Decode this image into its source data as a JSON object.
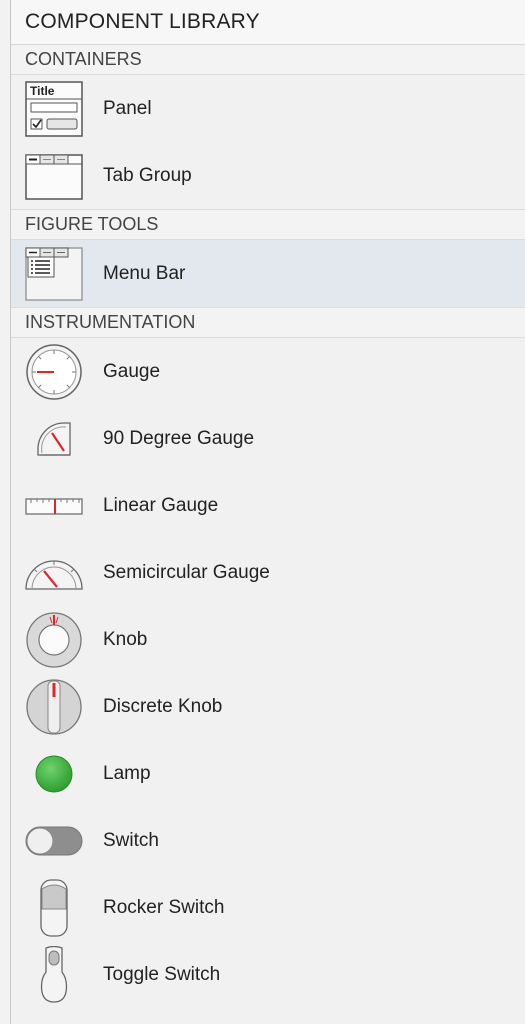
{
  "header": {
    "title": "COMPONENT LIBRARY"
  },
  "sections": {
    "containers": {
      "title": "CONTAINERS",
      "items": [
        {
          "label": "Panel",
          "icon": "panel-icon",
          "icon_text": "Title"
        },
        {
          "label": "Tab Group",
          "icon": "tab-group-icon"
        }
      ]
    },
    "figure_tools": {
      "title": "FIGURE TOOLS",
      "items": [
        {
          "label": "Menu Bar",
          "icon": "menu-bar-icon",
          "selected": true
        }
      ]
    },
    "instrumentation": {
      "title": "INSTRUMENTATION",
      "items": [
        {
          "label": "Gauge",
          "icon": "gauge-icon"
        },
        {
          "label": "90 Degree Gauge",
          "icon": "ninety-degree-gauge-icon"
        },
        {
          "label": "Linear Gauge",
          "icon": "linear-gauge-icon"
        },
        {
          "label": "Semicircular Gauge",
          "icon": "semicircular-gauge-icon"
        },
        {
          "label": "Knob",
          "icon": "knob-icon"
        },
        {
          "label": "Discrete Knob",
          "icon": "discrete-knob-icon"
        },
        {
          "label": "Lamp",
          "icon": "lamp-icon"
        },
        {
          "label": "Switch",
          "icon": "switch-icon"
        },
        {
          "label": "Rocker Switch",
          "icon": "rocker-switch-icon"
        },
        {
          "label": "Toggle Switch",
          "icon": "toggle-switch-icon"
        }
      ]
    }
  },
  "colors": {
    "selected_row": "#e3e8ef",
    "needle": "#e0262b",
    "lamp_green": "#3bb53b"
  }
}
